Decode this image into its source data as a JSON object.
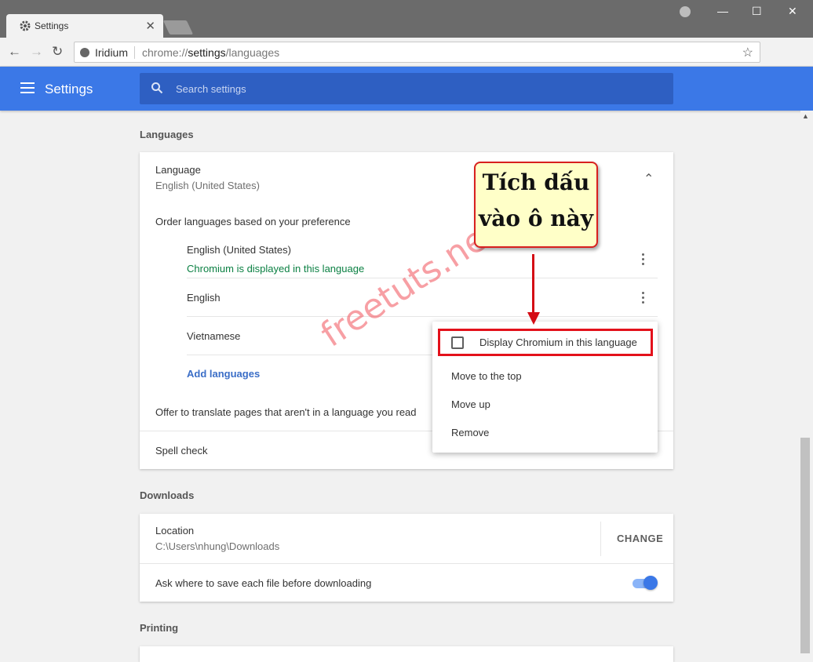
{
  "browser": {
    "tab_title": "Settings",
    "close_glyph": "✕",
    "site_name": "Iridium",
    "url_host": "chrome://",
    "url_path_bold": "settings",
    "url_rest": "/languages",
    "window_controls": [
      "—",
      "☐",
      "✕"
    ]
  },
  "header": {
    "title": "Settings",
    "search_placeholder": "Search settings"
  },
  "languages": {
    "section_title": "Languages",
    "language_label": "Language",
    "language_value": "English (United States)",
    "order_label": "Order languages based on your preference",
    "items": [
      {
        "name": "English (United States)",
        "note": "Chromium is displayed in this language"
      },
      {
        "name": "English",
        "note": ""
      },
      {
        "name": "Vietnamese",
        "note": ""
      }
    ],
    "add_languages": "Add languages",
    "translate_label": "Offer to translate pages that aren't in a language you read",
    "spell_check": "Spell check"
  },
  "context_menu": {
    "display_option": "Display Chromium in this language",
    "move_top": "Move to the top",
    "move_up": "Move up",
    "remove": "Remove"
  },
  "downloads": {
    "section_title": "Downloads",
    "location_label": "Location",
    "location_value": "C:\\Users\\nhung\\Downloads",
    "change_button": "CHANGE",
    "ask_label": "Ask where to save each file before downloading",
    "ask_enabled": true
  },
  "printing": {
    "section_title": "Printing"
  },
  "annotation": {
    "line1": "Tích dấu",
    "line2": "vào ô này"
  },
  "watermark": "freetuts.net",
  "colors": {
    "header_blue": "#3b78e7",
    "accent_green": "#0b8043",
    "annotation_red": "#e3111b"
  }
}
